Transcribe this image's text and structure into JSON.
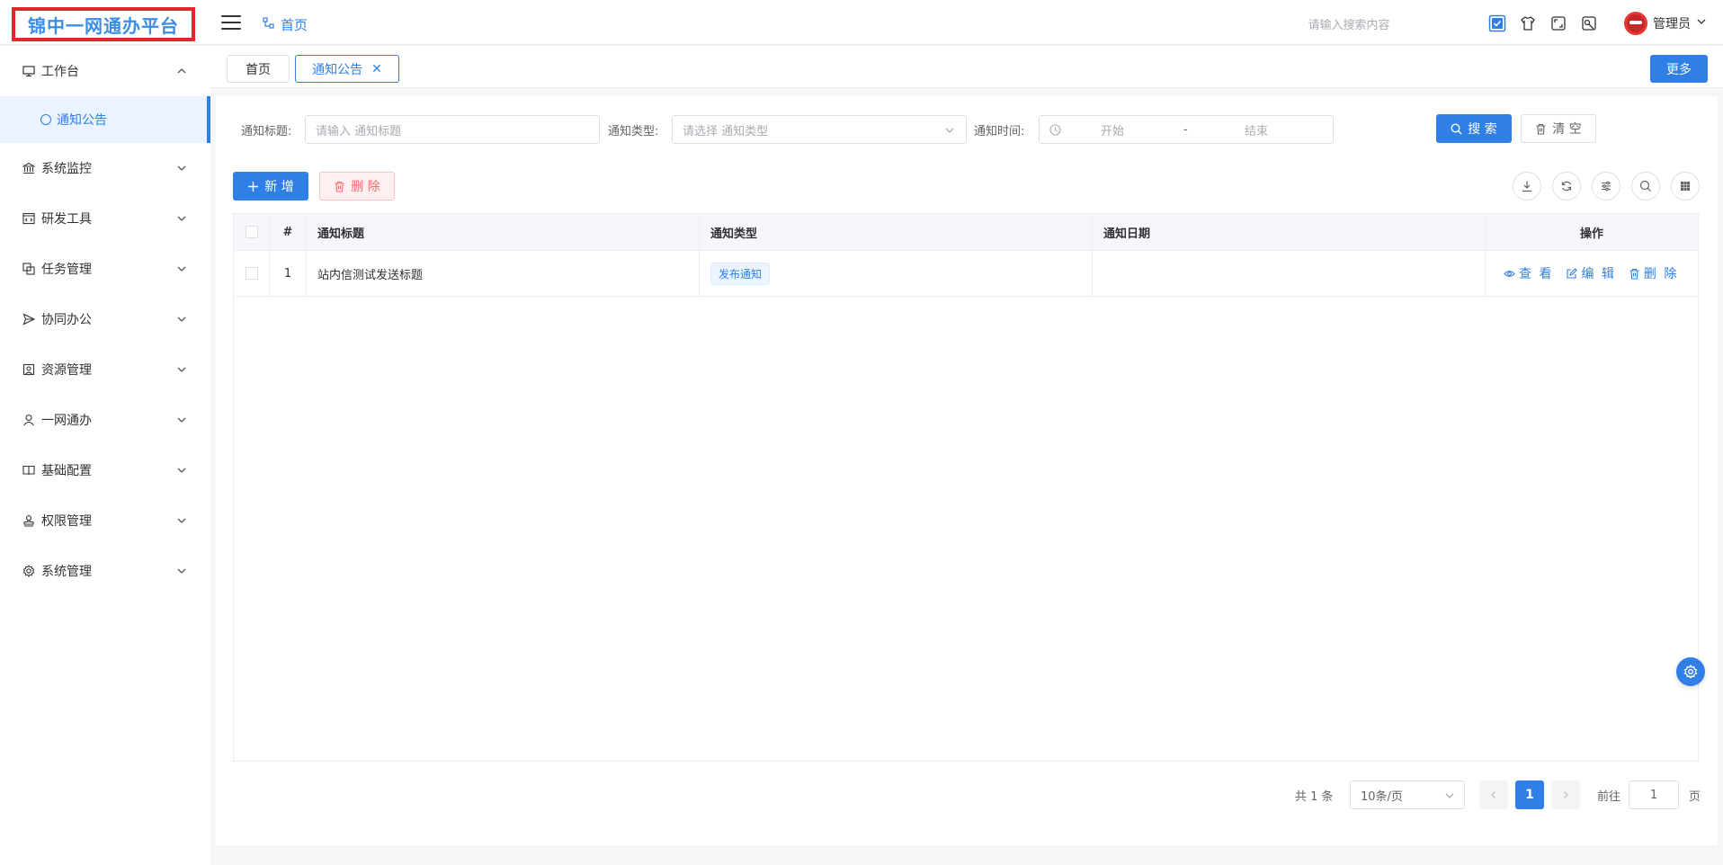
{
  "app": {
    "logo_text": "锦中一网通办平台",
    "breadcrumb_home": "首页"
  },
  "header": {
    "search_placeholder": "请输入搜索内容",
    "user_name": "管理员"
  },
  "sidebar": {
    "items": [
      {
        "label": "工作台",
        "icon": "monitor-icon",
        "expanded": true
      },
      {
        "label": "系统监控",
        "icon": "bank-icon"
      },
      {
        "label": "研发工具",
        "icon": "code-icon"
      },
      {
        "label": "任务管理",
        "icon": "copy-icon"
      },
      {
        "label": "协同办公",
        "icon": "send-icon"
      },
      {
        "label": "资源管理",
        "icon": "archive-icon"
      },
      {
        "label": "一网通办",
        "icon": "user-icon"
      },
      {
        "label": "基础配置",
        "icon": "book-icon"
      },
      {
        "label": "权限管理",
        "icon": "stamp-icon"
      },
      {
        "label": "系统管理",
        "icon": "gear-icon"
      }
    ],
    "active_sub": "通知公告"
  },
  "tabs": [
    {
      "label": "首页",
      "active": false
    },
    {
      "label": "通知公告",
      "active": true,
      "closable": true
    }
  ],
  "more_label": "更多",
  "filters": {
    "title_label": "通知标题:",
    "title_placeholder": "请输入 通知标题",
    "type_label": "通知类型:",
    "type_placeholder": "请选择 通知类型",
    "time_label": "通知时间:",
    "time_start": "开始",
    "time_sep": "-",
    "time_end": "结束",
    "search_btn": "搜 索",
    "clear_btn": "清 空"
  },
  "toolbar": {
    "add_btn": "新 增",
    "delete_btn": "删 除"
  },
  "table": {
    "columns": [
      "#",
      "通知标题",
      "通知类型",
      "通知日期",
      "操作"
    ],
    "rows": [
      {
        "index": "1",
        "title": "站内信测试发送标题",
        "type": "发布通知",
        "date": ""
      }
    ],
    "actions": {
      "view": "查 看",
      "edit": "编 辑",
      "delete": "删 除"
    }
  },
  "pagination": {
    "total": "共 1 条",
    "page_size": "10条/页",
    "current": "1",
    "goto_label": "前往",
    "goto_value": "1",
    "page_suffix": "页"
  },
  "colors": {
    "primary": "#2f7fe6",
    "logo_border": "#e3262b",
    "danger": "#f56c6c"
  }
}
